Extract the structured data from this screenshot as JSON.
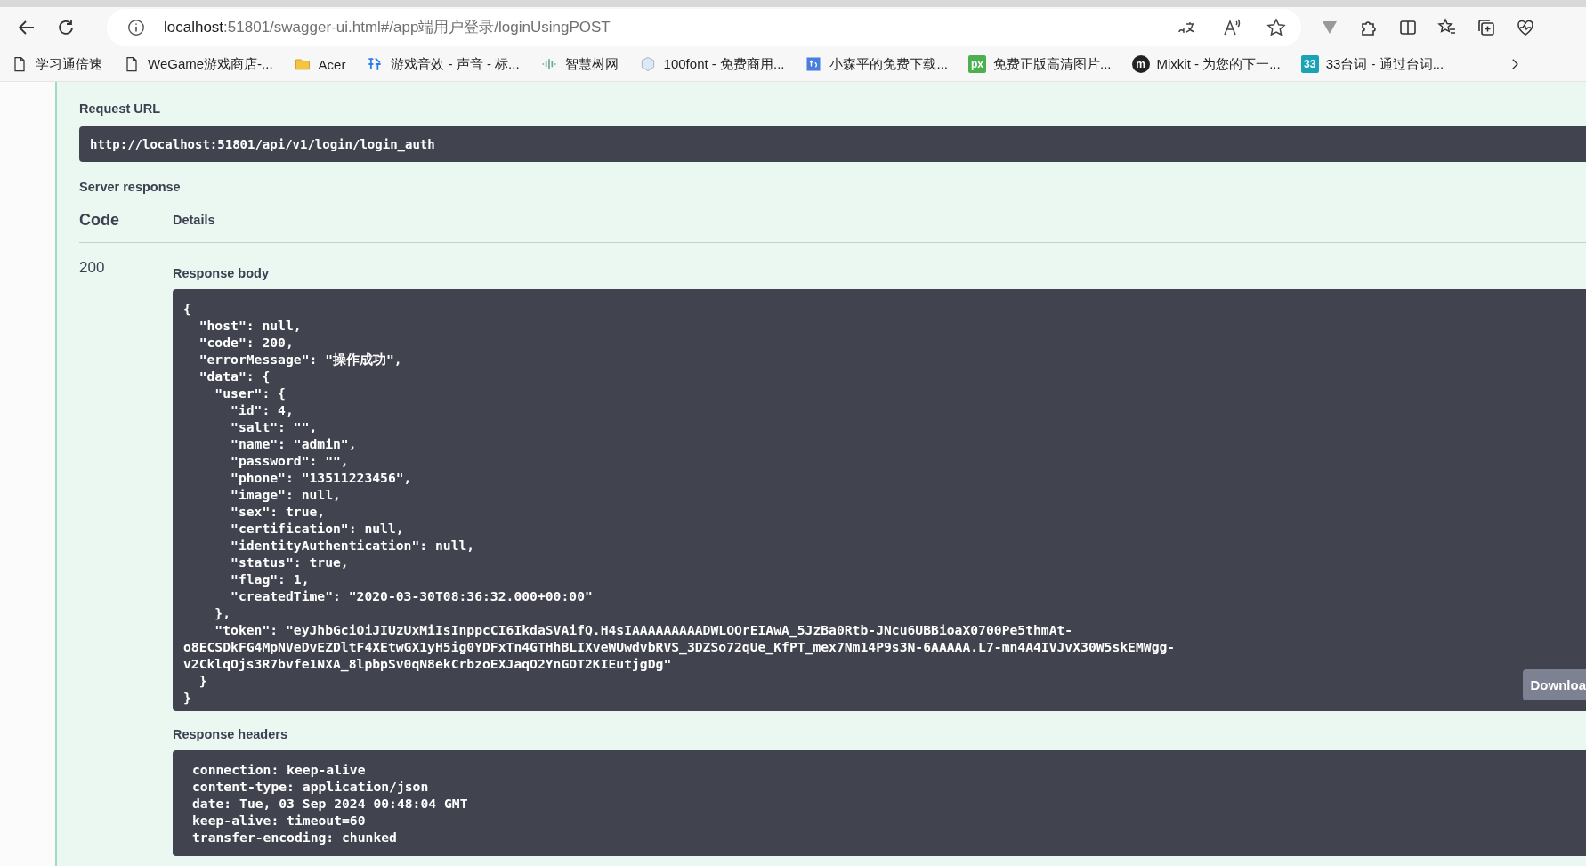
{
  "browser": {
    "url_host": "localhost",
    "url_rest": ":51801/swagger-ui.html#/app端用户登录/loginUsingPOST",
    "bookmarks": [
      {
        "label": "学习通倍速",
        "kind": "page"
      },
      {
        "label": "WeGame游戏商店-...",
        "kind": "page"
      },
      {
        "label": "Acer",
        "kind": "folder"
      },
      {
        "label": "游戏音效 - 声音 - 标...",
        "kind": "glyph"
      },
      {
        "label": "智慧树网",
        "kind": "bars"
      },
      {
        "label": "100font - 免费商用...",
        "kind": "cube"
      },
      {
        "label": "小森平的免费下载...",
        "kind": "tile"
      },
      {
        "label": "免费正版高清图片...",
        "kind": "badge",
        "badge": "px",
        "color": "#4caf50"
      },
      {
        "label": "Mixkit - 为您的下一...",
        "kind": "badge",
        "badge": "m",
        "color": "#222222"
      },
      {
        "label": "33台词 - 通过台词...",
        "kind": "badge",
        "badge": "33",
        "color": "#1aa3b5"
      }
    ]
  },
  "request_url": {
    "label": "Request URL",
    "value": "http://localhost:51801/api/v1/login/login_auth"
  },
  "server_response": {
    "label": "Server response",
    "columns": [
      "Code",
      "Details"
    ],
    "code": "200",
    "body_label": "Response body",
    "body": "{\n  \"host\": null,\n  \"code\": 200,\n  \"errorMessage\": \"操作成功\",\n  \"data\": {\n    \"user\": {\n      \"id\": 4,\n      \"salt\": \"\",\n      \"name\": \"admin\",\n      \"password\": \"\",\n      \"phone\": \"13511223456\",\n      \"image\": null,\n      \"sex\": true,\n      \"certification\": null,\n      \"identityAuthentication\": null,\n      \"status\": true,\n      \"flag\": 1,\n      \"createdTime\": \"2020-03-30T08:36:32.000+00:00\"\n    },\n    \"token\": \"eyJhbGciOiJIUzUxMiIsInppcCI6IkdaSVAifQ.H4sIAAAAAAAAADWLQQrEIAwA_5JzBa0Rtb-JNcu6UBBioaX0700Pe5thmAt-\no8ECSDkFG4MpNVeDvEZDltF4XEtwGX1yH5ig0YDFxTn4GTHhBLIXveWUwdvbRVS_3DZSo72qUe_KfPT_mex7Nm14P9s3N-6AAAAA.L7-mn4A4IVJvX30W5skEMWgg-\nv2CklqOjs3R7bvfe1NXA_8lpbpSv0qN8ekCrbzoEXJaqO2YnGOT2KIEutjgDg\"\n  }\n}",
    "download_button": "Downloa",
    "headers_label": "Response headers",
    "headers": "connection: keep-alive\ncontent-type: application/json\ndate: Tue, 03 Sep 2024 00:48:04 GMT\nkeep-alive: timeout=60\ntransfer-encoding: chunked"
  }
}
